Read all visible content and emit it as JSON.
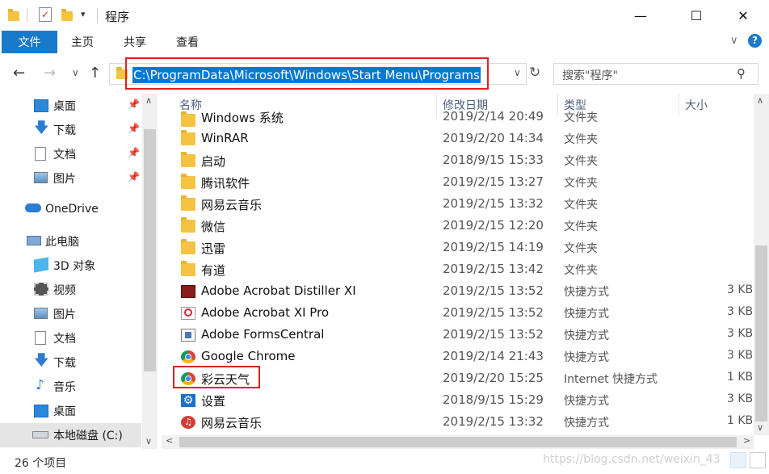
{
  "window": {
    "title": "程序",
    "minimize": "—",
    "maximize": "☐",
    "close": "✕"
  },
  "ribbon": {
    "file": "文件",
    "tabs": [
      "主页",
      "共享",
      "查看"
    ]
  },
  "address": {
    "path": "C:\\ProgramData\\Microsoft\\Windows\\Start Menu\\Programs",
    "search_placeholder": "搜索\"程序\""
  },
  "nav": {
    "quick_access": [
      {
        "label": "桌面",
        "icon": "desktop-icon",
        "pinned": true
      },
      {
        "label": "下载",
        "icon": "download-icon",
        "pinned": true
      },
      {
        "label": "文档",
        "icon": "document-icon",
        "pinned": true
      },
      {
        "label": "图片",
        "icon": "picture-icon",
        "pinned": true
      }
    ],
    "onedrive": "OneDrive",
    "this_pc": "此电脑",
    "pc_items": [
      {
        "label": "3D 对象",
        "icon": "3d-objects-icon"
      },
      {
        "label": "视频",
        "icon": "video-icon"
      },
      {
        "label": "图片",
        "icon": "picture-icon"
      },
      {
        "label": "文档",
        "icon": "document-icon"
      },
      {
        "label": "下载",
        "icon": "download-icon"
      },
      {
        "label": "音乐",
        "icon": "music-icon"
      },
      {
        "label": "桌面",
        "icon": "desktop-icon"
      },
      {
        "label": "本地磁盘 (C:)",
        "icon": "drive-icon"
      }
    ]
  },
  "columns": {
    "name": "名称",
    "date": "修改日期",
    "type": "类型",
    "size": "大小"
  },
  "files": [
    {
      "name": "Windows 系统",
      "date": "2019/2/14 20:49",
      "type": "文件夹",
      "size": "",
      "icon": "folder-icon"
    },
    {
      "name": "WinRAR",
      "date": "2019/2/20 14:34",
      "type": "文件夹",
      "size": "",
      "icon": "folder-icon"
    },
    {
      "name": "启动",
      "date": "2018/9/15 15:33",
      "type": "文件夹",
      "size": "",
      "icon": "folder-icon"
    },
    {
      "name": "腾讯软件",
      "date": "2019/2/15 13:27",
      "type": "文件夹",
      "size": "",
      "icon": "folder-icon"
    },
    {
      "name": "网易云音乐",
      "date": "2019/2/15 13:32",
      "type": "文件夹",
      "size": "",
      "icon": "folder-icon"
    },
    {
      "name": "微信",
      "date": "2019/2/15 12:20",
      "type": "文件夹",
      "size": "",
      "icon": "folder-icon"
    },
    {
      "name": "迅雷",
      "date": "2019/2/15 14:19",
      "type": "文件夹",
      "size": "",
      "icon": "folder-icon"
    },
    {
      "name": "有道",
      "date": "2019/2/15 13:42",
      "type": "文件夹",
      "size": "",
      "icon": "folder-icon"
    },
    {
      "name": "Adobe Acrobat Distiller XI",
      "date": "2019/2/15 13:52",
      "type": "快捷方式",
      "size": "3 KB",
      "icon": "acrobat-distiller-icon"
    },
    {
      "name": "Adobe Acrobat XI Pro",
      "date": "2019/2/15 13:52",
      "type": "快捷方式",
      "size": "3 KB",
      "icon": "acrobat-icon"
    },
    {
      "name": "Adobe FormsCentral",
      "date": "2019/2/15 13:52",
      "type": "快捷方式",
      "size": "3 KB",
      "icon": "formscentral-icon"
    },
    {
      "name": "Google Chrome",
      "date": "2019/2/14 21:43",
      "type": "快捷方式",
      "size": "3 KB",
      "icon": "chrome-icon"
    },
    {
      "name": "彩云天气",
      "date": "2019/2/20 15:25",
      "type": "Internet 快捷方式",
      "size": "1 KB",
      "icon": "chrome-icon"
    },
    {
      "name": "设置",
      "date": "2018/9/15 15:29",
      "type": "快捷方式",
      "size": "3 KB",
      "icon": "settings-gear-icon"
    },
    {
      "name": "网易云音乐",
      "date": "2019/2/15 13:32",
      "type": "快捷方式",
      "size": "1 KB",
      "icon": "netease-music-icon"
    }
  ],
  "status": {
    "count": "26 个项目",
    "watermark": "https://blog.csdn.net/weixin_43"
  }
}
